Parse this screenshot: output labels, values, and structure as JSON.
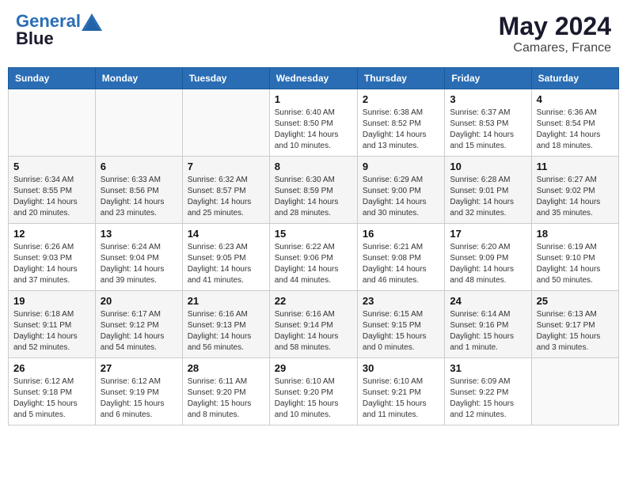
{
  "header": {
    "logo_line1": "General",
    "logo_line2": "Blue",
    "month": "May 2024",
    "location": "Camares, France"
  },
  "days_of_week": [
    "Sunday",
    "Monday",
    "Tuesday",
    "Wednesday",
    "Thursday",
    "Friday",
    "Saturday"
  ],
  "weeks": [
    [
      {
        "day": "",
        "info": ""
      },
      {
        "day": "",
        "info": ""
      },
      {
        "day": "",
        "info": ""
      },
      {
        "day": "1",
        "info": "Sunrise: 6:40 AM\nSunset: 8:50 PM\nDaylight: 14 hours\nand 10 minutes."
      },
      {
        "day": "2",
        "info": "Sunrise: 6:38 AM\nSunset: 8:52 PM\nDaylight: 14 hours\nand 13 minutes."
      },
      {
        "day": "3",
        "info": "Sunrise: 6:37 AM\nSunset: 8:53 PM\nDaylight: 14 hours\nand 15 minutes."
      },
      {
        "day": "4",
        "info": "Sunrise: 6:36 AM\nSunset: 8:54 PM\nDaylight: 14 hours\nand 18 minutes."
      }
    ],
    [
      {
        "day": "5",
        "info": "Sunrise: 6:34 AM\nSunset: 8:55 PM\nDaylight: 14 hours\nand 20 minutes."
      },
      {
        "day": "6",
        "info": "Sunrise: 6:33 AM\nSunset: 8:56 PM\nDaylight: 14 hours\nand 23 minutes."
      },
      {
        "day": "7",
        "info": "Sunrise: 6:32 AM\nSunset: 8:57 PM\nDaylight: 14 hours\nand 25 minutes."
      },
      {
        "day": "8",
        "info": "Sunrise: 6:30 AM\nSunset: 8:59 PM\nDaylight: 14 hours\nand 28 minutes."
      },
      {
        "day": "9",
        "info": "Sunrise: 6:29 AM\nSunset: 9:00 PM\nDaylight: 14 hours\nand 30 minutes."
      },
      {
        "day": "10",
        "info": "Sunrise: 6:28 AM\nSunset: 9:01 PM\nDaylight: 14 hours\nand 32 minutes."
      },
      {
        "day": "11",
        "info": "Sunrise: 6:27 AM\nSunset: 9:02 PM\nDaylight: 14 hours\nand 35 minutes."
      }
    ],
    [
      {
        "day": "12",
        "info": "Sunrise: 6:26 AM\nSunset: 9:03 PM\nDaylight: 14 hours\nand 37 minutes."
      },
      {
        "day": "13",
        "info": "Sunrise: 6:24 AM\nSunset: 9:04 PM\nDaylight: 14 hours\nand 39 minutes."
      },
      {
        "day": "14",
        "info": "Sunrise: 6:23 AM\nSunset: 9:05 PM\nDaylight: 14 hours\nand 41 minutes."
      },
      {
        "day": "15",
        "info": "Sunrise: 6:22 AM\nSunset: 9:06 PM\nDaylight: 14 hours\nand 44 minutes."
      },
      {
        "day": "16",
        "info": "Sunrise: 6:21 AM\nSunset: 9:08 PM\nDaylight: 14 hours\nand 46 minutes."
      },
      {
        "day": "17",
        "info": "Sunrise: 6:20 AM\nSunset: 9:09 PM\nDaylight: 14 hours\nand 48 minutes."
      },
      {
        "day": "18",
        "info": "Sunrise: 6:19 AM\nSunset: 9:10 PM\nDaylight: 14 hours\nand 50 minutes."
      }
    ],
    [
      {
        "day": "19",
        "info": "Sunrise: 6:18 AM\nSunset: 9:11 PM\nDaylight: 14 hours\nand 52 minutes."
      },
      {
        "day": "20",
        "info": "Sunrise: 6:17 AM\nSunset: 9:12 PM\nDaylight: 14 hours\nand 54 minutes."
      },
      {
        "day": "21",
        "info": "Sunrise: 6:16 AM\nSunset: 9:13 PM\nDaylight: 14 hours\nand 56 minutes."
      },
      {
        "day": "22",
        "info": "Sunrise: 6:16 AM\nSunset: 9:14 PM\nDaylight: 14 hours\nand 58 minutes."
      },
      {
        "day": "23",
        "info": "Sunrise: 6:15 AM\nSunset: 9:15 PM\nDaylight: 15 hours\nand 0 minutes."
      },
      {
        "day": "24",
        "info": "Sunrise: 6:14 AM\nSunset: 9:16 PM\nDaylight: 15 hours\nand 1 minute."
      },
      {
        "day": "25",
        "info": "Sunrise: 6:13 AM\nSunset: 9:17 PM\nDaylight: 15 hours\nand 3 minutes."
      }
    ],
    [
      {
        "day": "26",
        "info": "Sunrise: 6:12 AM\nSunset: 9:18 PM\nDaylight: 15 hours\nand 5 minutes."
      },
      {
        "day": "27",
        "info": "Sunrise: 6:12 AM\nSunset: 9:19 PM\nDaylight: 15 hours\nand 6 minutes."
      },
      {
        "day": "28",
        "info": "Sunrise: 6:11 AM\nSunset: 9:20 PM\nDaylight: 15 hours\nand 8 minutes."
      },
      {
        "day": "29",
        "info": "Sunrise: 6:10 AM\nSunset: 9:20 PM\nDaylight: 15 hours\nand 10 minutes."
      },
      {
        "day": "30",
        "info": "Sunrise: 6:10 AM\nSunset: 9:21 PM\nDaylight: 15 hours\nand 11 minutes."
      },
      {
        "day": "31",
        "info": "Sunrise: 6:09 AM\nSunset: 9:22 PM\nDaylight: 15 hours\nand 12 minutes."
      },
      {
        "day": "",
        "info": ""
      }
    ]
  ]
}
